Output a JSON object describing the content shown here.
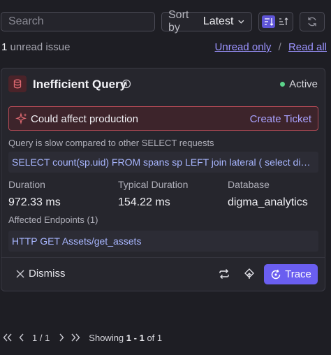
{
  "toolbar": {
    "search_placeholder": "Search",
    "sort_label": "Sort by",
    "sort_value": "Latest"
  },
  "unread": {
    "count": "1",
    "text": "unread issue",
    "unread_only_label": "Unread only",
    "separator": "/",
    "read_all_label": "Read all"
  },
  "issue": {
    "title": "Inefficient Query",
    "status": "Active",
    "alert_message": "Could affect production",
    "create_ticket_label": "Create Ticket",
    "description": "Query is slow compared to other SELECT requests",
    "query": "SELECT count(sp.uid) FROM spans sp LEFT join lateral ( select distinct ...",
    "metrics": [
      {
        "label": "Duration",
        "value": "972.33 ms"
      },
      {
        "label": "Typical Duration",
        "value": "154.22 ms"
      },
      {
        "label": "Database",
        "value": "digma_analytics"
      }
    ],
    "endpoints_label": "Affected Endpoints (1)",
    "endpoints": [
      "HTTP GET Assets/get_assets"
    ],
    "dismiss_label": "Dismiss",
    "trace_label": "Trace"
  },
  "pagination": {
    "pages": "1 / 1",
    "showing_prefix": "Showing",
    "showing_range": "1 - 1",
    "showing_suffix": "of 1"
  },
  "colors": {
    "accent": "#6a5ef0",
    "link": "#9b93ff",
    "active_dot": "#5bd38a",
    "alert_border": "#b34a55"
  }
}
